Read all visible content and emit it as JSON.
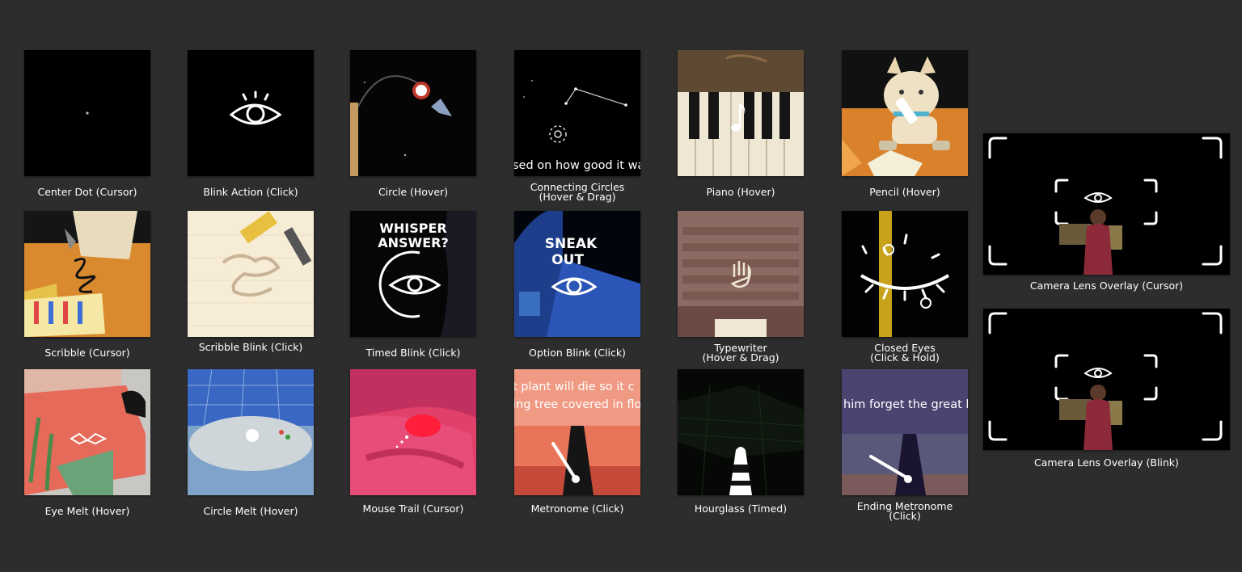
{
  "tiles": [
    {
      "lines": [
        "Center Dot (Cursor)"
      ]
    },
    {
      "lines": [
        "Blink Action (Click)"
      ]
    },
    {
      "lines": [
        "Circle (Hover)"
      ]
    },
    {
      "lines": [
        "Connecting Circles",
        "(Hover & Drag)"
      ],
      "caption": "sed on how good it was"
    },
    {
      "lines": [
        "Piano (Hover)"
      ]
    },
    {
      "lines": [
        "Pencil (Hover)"
      ]
    },
    {
      "lines": [
        "Scribble (Cursor)"
      ]
    },
    {
      "lines": [
        "Scribble Blink (Click)"
      ]
    },
    {
      "lines": [
        "Timed Blink (Click)"
      ],
      "caption1": "WHISPER",
      "caption2": "ANSWER?"
    },
    {
      "lines": [
        "Option Blink (Click)"
      ],
      "caption1": "SNEAK",
      "caption2": "OUT"
    },
    {
      "lines": [
        "Typewriter",
        "(Hover & Drag)"
      ]
    },
    {
      "lines": [
        "Closed Eyes",
        "(Click & Hold)"
      ]
    },
    {
      "lines": [
        "Eye Melt (Hover)"
      ]
    },
    {
      "lines": [
        "Circle Melt (Hover)"
      ]
    },
    {
      "lines": [
        "Mouse Trail (Cursor)"
      ]
    },
    {
      "lines": [
        "Metronome (Click)"
      ],
      "caption1": "t plant will die so it c",
      "caption2": "ing tree covered in flo"
    },
    {
      "lines": [
        "Hourglass (Timed)"
      ]
    },
    {
      "lines": [
        "Ending Metronome",
        "(Click)"
      ],
      "caption": "him forget the great lif"
    },
    {
      "lines": [
        "Camera Lens Overlay (Cursor)"
      ]
    },
    {
      "lines": [
        "Camera Lens Overlay (Blink)"
      ]
    }
  ],
  "icons": [
    "dot-icon",
    "eye-icon",
    "cursor-circle-icon",
    "constellation-icon",
    "music-note-icon",
    "pencil-icon",
    "scribble-icon",
    "hand-icon",
    "metronome-icon",
    "hourglass-icon",
    "viewfinder-icon"
  ]
}
